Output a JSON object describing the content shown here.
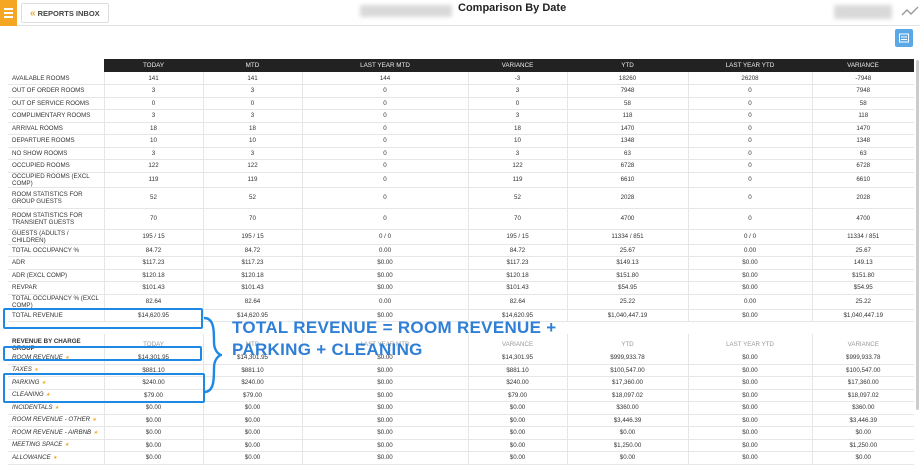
{
  "header": {
    "back_label": "REPORTS INBOX",
    "title": "Comparison By Date"
  },
  "columns": [
    "",
    "TODAY",
    "MTD",
    "LAST YEAR MTD",
    "VARIANCE",
    "YTD",
    "LAST YEAR YTD",
    "VARIANCE"
  ],
  "rows": [
    {
      "label": "AVAILABLE ROOMS",
      "vals": [
        "141",
        "141",
        "144",
        "-3",
        "18260",
        "26208",
        "-7948"
      ],
      "neg": [
        3,
        6
      ]
    },
    {
      "label": "OUT OF ORDER ROOMS",
      "vals": [
        "3",
        "3",
        "0",
        "3",
        "7948",
        "0",
        "7948"
      ]
    },
    {
      "label": "OUT OF SERVICE ROOMS",
      "vals": [
        "0",
        "0",
        "0",
        "0",
        "58",
        "0",
        "58"
      ]
    },
    {
      "label": "COMPLIMENTARY ROOMS",
      "vals": [
        "3",
        "3",
        "0",
        "3",
        "118",
        "0",
        "118"
      ]
    },
    {
      "label": "ARRIVAL ROOMS",
      "vals": [
        "18",
        "18",
        "0",
        "18",
        "1470",
        "0",
        "1470"
      ]
    },
    {
      "label": "DEPARTURE ROOMS",
      "vals": [
        "10",
        "10",
        "0",
        "10",
        "1348",
        "0",
        "1348"
      ]
    },
    {
      "label": "NO SHOW ROOMS",
      "vals": [
        "3",
        "3",
        "0",
        "3",
        "63",
        "0",
        "63"
      ]
    },
    {
      "label": "OCCUPIED ROOMS",
      "vals": [
        "122",
        "122",
        "0",
        "122",
        "6728",
        "0",
        "6728"
      ]
    },
    {
      "label": "OCCUPIED ROOMS (EXCL COMP)",
      "vals": [
        "119",
        "119",
        "0",
        "119",
        "6610",
        "0",
        "6610"
      ]
    },
    {
      "label": "ROOM STATISTICS FOR GROUP GUESTS",
      "vals": [
        "52",
        "52",
        "0",
        "52",
        "2028",
        "0",
        "2028"
      ],
      "tall": true
    },
    {
      "label": "ROOM STATISTICS FOR TRANSIENT GUESTS",
      "vals": [
        "70",
        "70",
        "0",
        "70",
        "4700",
        "0",
        "4700"
      ],
      "tall": true
    },
    {
      "label": "GUESTS (ADULTS / CHILDREN)",
      "vals": [
        "195 / 15",
        "195 / 15",
        "0 / 0",
        "195 / 15",
        "11334 / 851",
        "0 / 0",
        "11334 / 851"
      ]
    },
    {
      "label": "TOTAL OCCUPANCY %",
      "vals": [
        "84.72",
        "84.72",
        "0.00",
        "84.72",
        "25.67",
        "0.00",
        "25.67"
      ]
    },
    {
      "label": "ADR",
      "vals": [
        "$117.23",
        "$117.23",
        "$0.00",
        "$117.23",
        "$149.13",
        "$0.00",
        "149.13"
      ]
    },
    {
      "label": "ADR (EXCL COMP)",
      "vals": [
        "$120.18",
        "$120.18",
        "$0.00",
        "$120.18",
        "$151.80",
        "$0.00",
        "$151.80"
      ]
    },
    {
      "label": "REVPAR",
      "vals": [
        "$101.43",
        "$101.43",
        "$0.00",
        "$101.43",
        "$54.95",
        "$0.00",
        "$54.95"
      ]
    },
    {
      "label": "TOTAL OCCUPANCY % (EXCL COMP)",
      "vals": [
        "82.64",
        "82.64",
        "0.00",
        "82.64",
        "25.22",
        "0.00",
        "25.22"
      ]
    },
    {
      "label": "TOTAL REVENUE",
      "vals": [
        "$14,620.95",
        "$14,620.95",
        "$0.00",
        "$14,620.95",
        "$1,040,447.19",
        "$0.00",
        "$1,040,447.19"
      ],
      "sp": true
    }
  ],
  "section": {
    "label": "REVENUE BY CHARGE GROUP",
    "subs": [
      "TODAY",
      "MTD",
      "LAST YEAR MTD",
      "VARIANCE",
      "YTD",
      "LAST YEAR YTD",
      "VARIANCE"
    ]
  },
  "charges": [
    {
      "label": "ROOM REVENUE",
      "vals": [
        "$14,301.95",
        "$14,301.95",
        "$0.00",
        "$14,301.95",
        "$999,933.78",
        "$0.00",
        "$999,933.78"
      ]
    },
    {
      "label": "TAXES",
      "vals": [
        "$881.10",
        "$881.10",
        "$0.00",
        "$881.10",
        "$100,547.00",
        "$0.00",
        "$100,547.00"
      ]
    },
    {
      "label": "PARKING",
      "vals": [
        "$240.00",
        "$240.00",
        "$0.00",
        "$240.00",
        "$17,360.00",
        "$0.00",
        "$17,360.00"
      ]
    },
    {
      "label": "CLEANING",
      "vals": [
        "$79.00",
        "$79.00",
        "$0.00",
        "$79.00",
        "$18,097.02",
        "$0.00",
        "$18,097.02"
      ]
    },
    {
      "label": "INCIDENTALS",
      "vals": [
        "$0.00",
        "$0.00",
        "$0.00",
        "$0.00",
        "$360.00",
        "$0.00",
        "$360.00"
      ]
    },
    {
      "label": "ROOM REVENUE - OTHER",
      "vals": [
        "$0.00",
        "$0.00",
        "$0.00",
        "$0.00",
        "$3,446.39",
        "$0.00",
        "$3,446.39"
      ]
    },
    {
      "label": "ROOM REVENUE - AIRBNB",
      "vals": [
        "$0.00",
        "$0.00",
        "$0.00",
        "$0.00",
        "$0.00",
        "$0.00",
        "$0.00"
      ]
    },
    {
      "label": "MEETING SPACE",
      "vals": [
        "$0.00",
        "$0.00",
        "$0.00",
        "$0.00",
        "$1,250.00",
        "$0.00",
        "$1,250.00"
      ]
    },
    {
      "label": "ALLOWANCE",
      "vals": [
        "$0.00",
        "$0.00",
        "$0.00",
        "$0.00",
        "$0.00",
        "$0.00",
        "$0.00"
      ]
    }
  ],
  "annotation": {
    "line1": "TOTAL REVENUE = ROOM REVENUE +",
    "line2": "PARKING + CLEANING"
  },
  "colors": {
    "accent": "#f5a623",
    "highlight": "#1e88e5",
    "negative": "#e53935"
  }
}
